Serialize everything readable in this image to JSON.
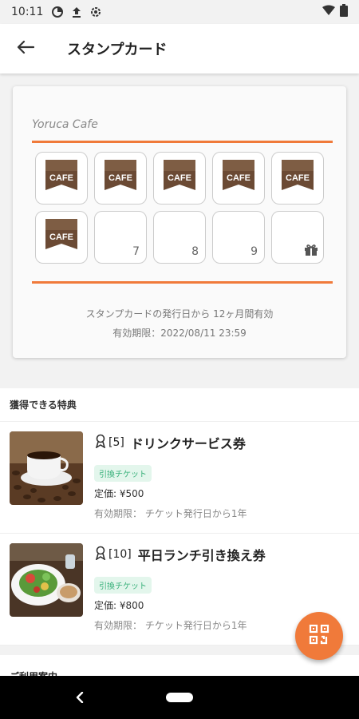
{
  "status_bar": {
    "time": "10:11",
    "icons": [
      "data-saver-icon",
      "upload-icon",
      "settings-icon",
      "wifi-icon",
      "battery-icon"
    ]
  },
  "app_bar": {
    "back_icon": "arrow-left-icon",
    "title": "スタンプカード"
  },
  "stamp_card": {
    "shop_name": "Yoruca Cafe",
    "stamp_label": "CAFE",
    "slots": [
      {
        "stamped": true,
        "number": ""
      },
      {
        "stamped": true,
        "number": ""
      },
      {
        "stamped": true,
        "number": ""
      },
      {
        "stamped": true,
        "number": ""
      },
      {
        "stamped": true,
        "number": ""
      },
      {
        "stamped": true,
        "number": ""
      },
      {
        "stamped": false,
        "number": "7"
      },
      {
        "stamped": false,
        "number": "8"
      },
      {
        "stamped": false,
        "number": "9"
      },
      {
        "stamped": false,
        "number": "",
        "icon": "gift-icon"
      }
    ],
    "validity_note": "スタンプカードの発行日から 12ヶ月間有効",
    "expiry": "有効期限：2022/08/11 23:59"
  },
  "benefits": {
    "header": "獲得できる特典",
    "items": [
      {
        "count": "[5]",
        "title": "ドリンクサービス券",
        "tag": "引換チケット",
        "price": "定価: ¥500",
        "expiry": "有効期限： チケット発行日から1年",
        "image": "coffee-photo"
      },
      {
        "count": "[10]",
        "title": "平日ランチ引き換え券",
        "tag": "引換チケット",
        "price": "定価: ¥800",
        "expiry": "有効期限： チケット発行日から1年",
        "image": "lunch-photo"
      }
    ]
  },
  "guide": {
    "header": "ご利用案内"
  },
  "fab": {
    "icon": "qr-code-icon"
  },
  "colors": {
    "accent": "#f07a3a",
    "tag_bg": "#e3f6ec",
    "tag_text": "#38b07a",
    "stamp_brown": "#6b4a34"
  }
}
